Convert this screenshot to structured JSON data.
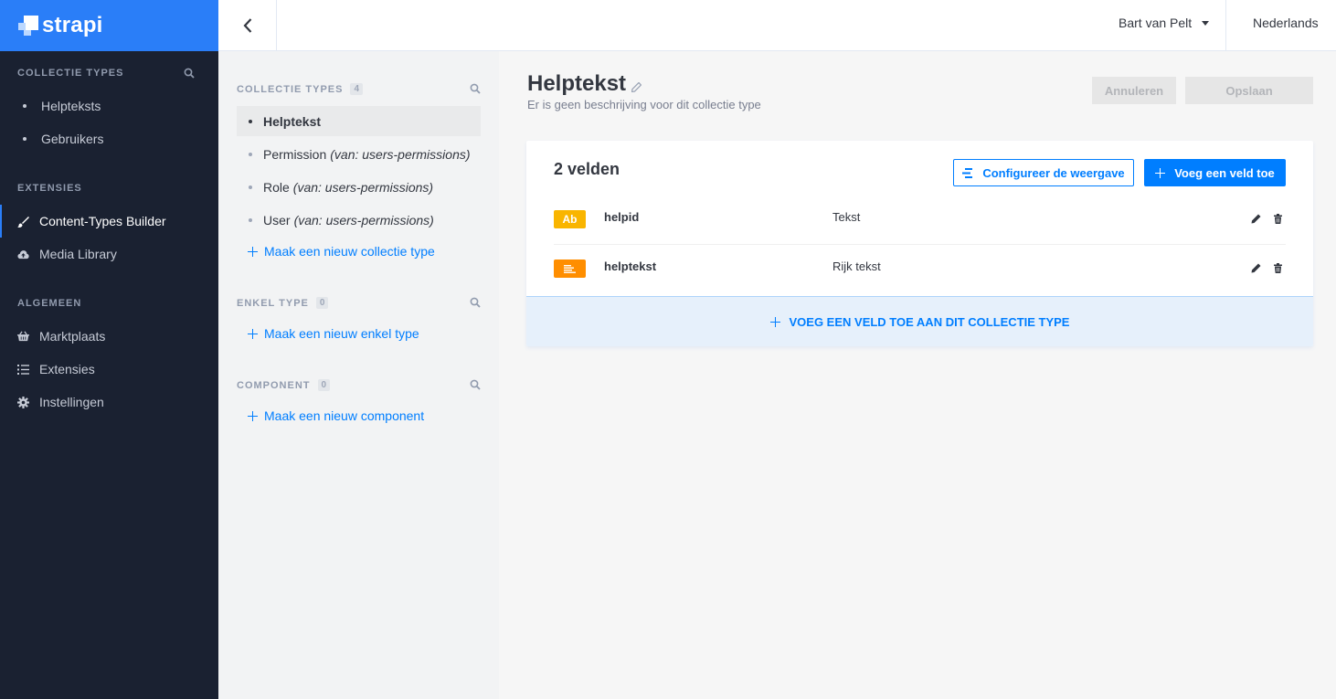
{
  "brand": {
    "name": "strapi"
  },
  "leftnav": {
    "sections": {
      "collection_types": "COLLECTIE TYPES",
      "extensions": "EXTENSIES",
      "general": "ALGEMEEN"
    },
    "collection_items": [
      {
        "label": "Helpteksts"
      },
      {
        "label": "Gebruikers"
      }
    ],
    "extension_items": [
      {
        "label": "Content-Types Builder",
        "icon": "paint-brush-icon",
        "active": true
      },
      {
        "label": "Media Library",
        "icon": "cloud-upload-icon",
        "active": false
      }
    ],
    "general_items": [
      {
        "label": "Marktplaats",
        "icon": "shopping-basket-icon"
      },
      {
        "label": "Extensies",
        "icon": "list-icon"
      },
      {
        "label": "Instellingen",
        "icon": "gear-icon"
      }
    ]
  },
  "header": {
    "user_name": "Bart van Pelt",
    "language": "Nederlands"
  },
  "subnav": {
    "collection_types": {
      "title": "COLLECTIE TYPES",
      "count": "4",
      "items": [
        {
          "label": "Helptekst",
          "suffix": "",
          "active": true
        },
        {
          "label": "Permission",
          "suffix": "(van: users-permissions)",
          "active": false
        },
        {
          "label": "Role",
          "suffix": "(van: users-permissions)",
          "active": false
        },
        {
          "label": "User",
          "suffix": "(van: users-permissions)",
          "active": false
        }
      ],
      "add_label": "Maak een nieuw collectie type"
    },
    "single_types": {
      "title": "ENKEL TYPE",
      "count": "0",
      "add_label": "Maak een nieuw enkel type"
    },
    "components": {
      "title": "COMPONENT",
      "count": "0",
      "add_label": "Maak een nieuw component"
    }
  },
  "main": {
    "title": "Helptekst",
    "description": "Er is geen beschrijving voor dit collectie type",
    "cancel_label": "Annuleren",
    "save_label": "Opslaan",
    "card": {
      "title": "2 velden",
      "configure_label": "Configureer de weergave",
      "add_field_label": "Voeg een veld toe",
      "fields": [
        {
          "badge": "Ab",
          "badge_color": "#f9b500",
          "name": "helpid",
          "type": "Tekst"
        },
        {
          "badge": "",
          "badge_color": "#ff8e00",
          "badge_icon": "rich-text-icon",
          "name": "helptekst",
          "type": "Rijk tekst"
        }
      ],
      "footer_label": "VOEG EEN VELD TOE AAN DIT COLLECTIE TYPE"
    }
  },
  "colors": {
    "primary": "#007eff",
    "brand": "#2a7ef8",
    "nav_bg": "#1a2131"
  }
}
